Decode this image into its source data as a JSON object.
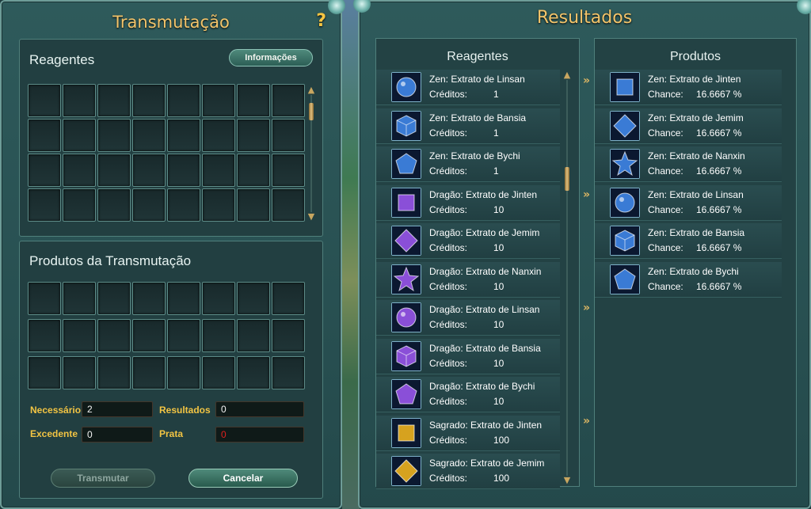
{
  "transmutation": {
    "title": "Transmutação",
    "help_glyph": "?",
    "reagents_label": "Reagentes",
    "info_button_label": "Informações",
    "products_label": "Produtos da Transmutação",
    "fields": {
      "required_label": "Necessário",
      "required_value": "2",
      "results_label": "Resultados",
      "results_value": "0",
      "excess_label": "Excedente",
      "excess_value": "0",
      "silver_label": "Prata",
      "silver_value": "0"
    },
    "transmute_button_label": "Transmutar",
    "cancel_button_label": "Cancelar"
  },
  "results": {
    "title": "Resultados",
    "reagents_header": "Reagentes",
    "products_header": "Produtos",
    "arrow_glyph": "»",
    "reagents": [
      {
        "name": "Zen: Extrato de Linsan",
        "key": "Créditos:",
        "value": "1",
        "icon": "blue-orb-icon",
        "color": "#3a7bd5"
      },
      {
        "name": "Zen: Extrato de Bansia",
        "key": "Créditos:",
        "value": "1",
        "icon": "blue-cube-icon",
        "color": "#3a7bd5"
      },
      {
        "name": "Zen: Extrato de Bychi",
        "key": "Créditos:",
        "value": "1",
        "icon": "blue-pentagon-icon",
        "color": "#3a7bd5"
      },
      {
        "name": "Dragão: Extrato de Jinten",
        "key": "Créditos:",
        "value": "10",
        "icon": "purple-square-icon",
        "color": "#8a4fd8"
      },
      {
        "name": "Dragão: Extrato de Jemim",
        "key": "Créditos:",
        "value": "10",
        "icon": "purple-diamond-icon",
        "color": "#8a4fd8"
      },
      {
        "name": "Dragão: Extrato de Nanxin",
        "key": "Créditos:",
        "value": "10",
        "icon": "purple-star-icon",
        "color": "#8a4fd8"
      },
      {
        "name": "Dragão: Extrato de Linsan",
        "key": "Créditos:",
        "value": "10",
        "icon": "purple-orb-icon",
        "color": "#8a4fd8"
      },
      {
        "name": "Dragão: Extrato de Bansia",
        "key": "Créditos:",
        "value": "10",
        "icon": "purple-cube-icon",
        "color": "#8a4fd8"
      },
      {
        "name": "Dragão: Extrato de Bychi",
        "key": "Créditos:",
        "value": "10",
        "icon": "purple-pentagon-icon",
        "color": "#8a4fd8"
      },
      {
        "name": "Sagrado: Extrato de Jinten",
        "key": "Créditos:",
        "value": "100",
        "icon": "gold-square-icon",
        "color": "#d6a21f"
      },
      {
        "name": "Sagrado: Extrato de Jemim",
        "key": "Créditos:",
        "value": "100",
        "icon": "gold-diamond-icon",
        "color": "#d6a21f"
      }
    ],
    "products": [
      {
        "name": "Zen: Extrato de Jinten",
        "key": "Chance:",
        "value": "16.6667 %",
        "icon": "blue-square-icon",
        "color": "#3a7bd5"
      },
      {
        "name": "Zen: Extrato de Jemim",
        "key": "Chance:",
        "value": "16.6667 %",
        "icon": "blue-diamond-icon",
        "color": "#3a7bd5"
      },
      {
        "name": "Zen: Extrato de Nanxin",
        "key": "Chance:",
        "value": "16.6667 %",
        "icon": "blue-star-icon",
        "color": "#3a7bd5"
      },
      {
        "name": "Zen: Extrato de Linsan",
        "key": "Chance:",
        "value": "16.6667 %",
        "icon": "blue-orb-icon",
        "color": "#3a7bd5"
      },
      {
        "name": "Zen: Extrato de Bansia",
        "key": "Chance:",
        "value": "16.6667 %",
        "icon": "blue-cube-icon",
        "color": "#3a7bd5"
      },
      {
        "name": "Zen: Extrato de Bychi",
        "key": "Chance:",
        "value": "16.6667 %",
        "icon": "blue-pentagon-icon",
        "color": "#3a7bd5"
      }
    ]
  },
  "colors": {
    "title": "#f3c46a",
    "label_gold": "#f2c443",
    "silver_value": "#e0201e"
  }
}
